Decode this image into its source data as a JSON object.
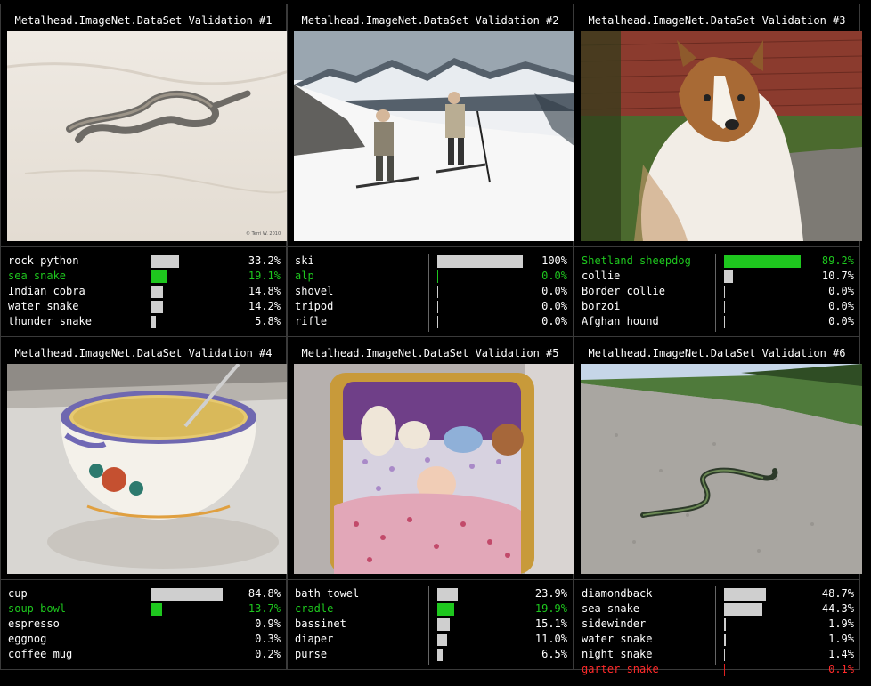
{
  "colors": {
    "background": "#000000",
    "bar_default": "#cfcfcf",
    "correct_green": "#1ec71e",
    "wrong_red": "#ff2a2a"
  },
  "panels": [
    {
      "title": "Metalhead.ImageNet.DataSet Validation #1",
      "image": "snake-on-sand-photo",
      "photo_caption": "© Terri W. 2010",
      "predictions": [
        {
          "label": "rock python",
          "pct": "33.2%",
          "value": 33.2,
          "status": "default"
        },
        {
          "label": "sea snake",
          "pct": "19.1%",
          "value": 19.1,
          "status": "correct"
        },
        {
          "label": "Indian cobra",
          "pct": "14.8%",
          "value": 14.8,
          "status": "default"
        },
        {
          "label": "water snake",
          "pct": "14.2%",
          "value": 14.2,
          "status": "default"
        },
        {
          "label": "thunder snake",
          "pct": "5.8%",
          "value": 5.8,
          "status": "default"
        }
      ]
    },
    {
      "title": "Metalhead.ImageNet.DataSet Validation #2",
      "image": "skiers-on-mountain-photo",
      "predictions": [
        {
          "label": "ski",
          "pct": "100%",
          "value": 100,
          "status": "default"
        },
        {
          "label": "alp",
          "pct": "0.0%",
          "value": 0.0,
          "status": "correct"
        },
        {
          "label": "shovel",
          "pct": "0.0%",
          "value": 0.0,
          "status": "default"
        },
        {
          "label": "tripod",
          "pct": "0.0%",
          "value": 0.0,
          "status": "default"
        },
        {
          "label": "rifle",
          "pct": "0.0%",
          "value": 0.0,
          "status": "default"
        }
      ]
    },
    {
      "title": "Metalhead.ImageNet.DataSet Validation #3",
      "image": "sheltie-dog-photo",
      "predictions": [
        {
          "label": "Shetland sheepdog",
          "pct": "89.2%",
          "value": 89.2,
          "status": "correct"
        },
        {
          "label": "collie",
          "pct": "10.7%",
          "value": 10.7,
          "status": "default"
        },
        {
          "label": "Border collie",
          "pct": "0.0%",
          "value": 0.0,
          "status": "default"
        },
        {
          "label": "borzoi",
          "pct": "0.0%",
          "value": 0.0,
          "status": "default"
        },
        {
          "label": "Afghan hound",
          "pct": "0.0%",
          "value": 0.0,
          "status": "default"
        }
      ]
    },
    {
      "title": "Metalhead.ImageNet.DataSet Validation #4",
      "image": "soup-bowl-photo",
      "predictions": [
        {
          "label": "cup",
          "pct": "84.8%",
          "value": 84.8,
          "status": "default"
        },
        {
          "label": "soup bowl",
          "pct": "13.7%",
          "value": 13.7,
          "status": "correct"
        },
        {
          "label": "espresso",
          "pct": "0.9%",
          "value": 0.9,
          "status": "default"
        },
        {
          "label": "eggnog",
          "pct": "0.3%",
          "value": 0.3,
          "status": "default"
        },
        {
          "label": "coffee mug",
          "pct": "0.2%",
          "value": 0.2,
          "status": "default"
        }
      ]
    },
    {
      "title": "Metalhead.ImageNet.DataSet Validation #5",
      "image": "baby-in-cradle-photo",
      "predictions": [
        {
          "label": "bath towel",
          "pct": "23.9%",
          "value": 23.9,
          "status": "default"
        },
        {
          "label": "cradle",
          "pct": "19.9%",
          "value": 19.9,
          "status": "correct"
        },
        {
          "label": "bassinet",
          "pct": "15.1%",
          "value": 15.1,
          "status": "default"
        },
        {
          "label": "diaper",
          "pct": "11.0%",
          "value": 11.0,
          "status": "default"
        },
        {
          "label": "purse",
          "pct": "6.5%",
          "value": 6.5,
          "status": "default"
        }
      ]
    },
    {
      "title": "Metalhead.ImageNet.DataSet Validation #6",
      "image": "snake-on-road-photo",
      "predictions": [
        {
          "label": "diamondback",
          "pct": "48.7%",
          "value": 48.7,
          "status": "default"
        },
        {
          "label": "sea snake",
          "pct": "44.3%",
          "value": 44.3,
          "status": "default"
        },
        {
          "label": "sidewinder",
          "pct": "1.9%",
          "value": 1.9,
          "status": "default"
        },
        {
          "label": "water snake",
          "pct": "1.9%",
          "value": 1.9,
          "status": "default"
        },
        {
          "label": "night snake",
          "pct": "1.4%",
          "value": 1.4,
          "status": "default"
        },
        {
          "label": "garter snake",
          "pct": "0.1%",
          "value": 0.1,
          "status": "wrong"
        }
      ]
    }
  ]
}
